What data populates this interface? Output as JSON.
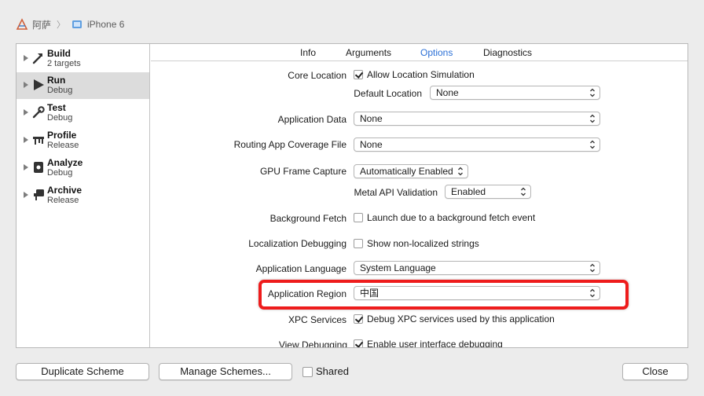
{
  "breadcrumb": {
    "project": "阿萨",
    "device": "iPhone 6"
  },
  "sidebar": {
    "items": [
      {
        "name": "Build",
        "sub": "2 targets",
        "icon": "hammer-icon"
      },
      {
        "name": "Run",
        "sub": "Debug",
        "icon": "play-icon"
      },
      {
        "name": "Test",
        "sub": "Debug",
        "icon": "wrench-icon"
      },
      {
        "name": "Profile",
        "sub": "Release",
        "icon": "profile-icon"
      },
      {
        "name": "Analyze",
        "sub": "Debug",
        "icon": "analyze-icon"
      },
      {
        "name": "Archive",
        "sub": "Release",
        "icon": "archive-icon"
      }
    ],
    "selected": "Run"
  },
  "tabs": [
    "Info",
    "Arguments",
    "Options",
    "Diagnostics"
  ],
  "active_tab": "Options",
  "options": {
    "core_location_label": "Core Location",
    "allow_location_simulation": "Allow Location Simulation",
    "default_location_label": "Default Location",
    "default_location_value": "None",
    "application_data_label": "Application Data",
    "application_data_value": "None",
    "routing_label": "Routing App Coverage File",
    "routing_value": "None",
    "gpu_label": "GPU Frame Capture",
    "gpu_value": "Automatically Enabled",
    "metal_label": "Metal API Validation",
    "metal_value": "Enabled",
    "bg_fetch_label": "Background Fetch",
    "bg_fetch_check": "Launch due to a background fetch event",
    "loc_debug_label": "Localization Debugging",
    "loc_debug_check": "Show non-localized strings",
    "app_lang_label": "Application Language",
    "app_lang_value": "System Language",
    "app_region_label": "Application Region",
    "app_region_value": "中国",
    "xpc_label": "XPC Services",
    "xpc_check": "Debug XPC services used by this application",
    "view_debug_label": "View Debugging",
    "view_debug_check": "Enable user interface debugging"
  },
  "footer": {
    "duplicate": "Duplicate Scheme",
    "manage": "Manage Schemes...",
    "shared": "Shared",
    "close": "Close"
  },
  "colors": {
    "accent": "#2a6fd6",
    "highlight": "#ee1c1c",
    "selected_row": "#dcdcdc"
  }
}
